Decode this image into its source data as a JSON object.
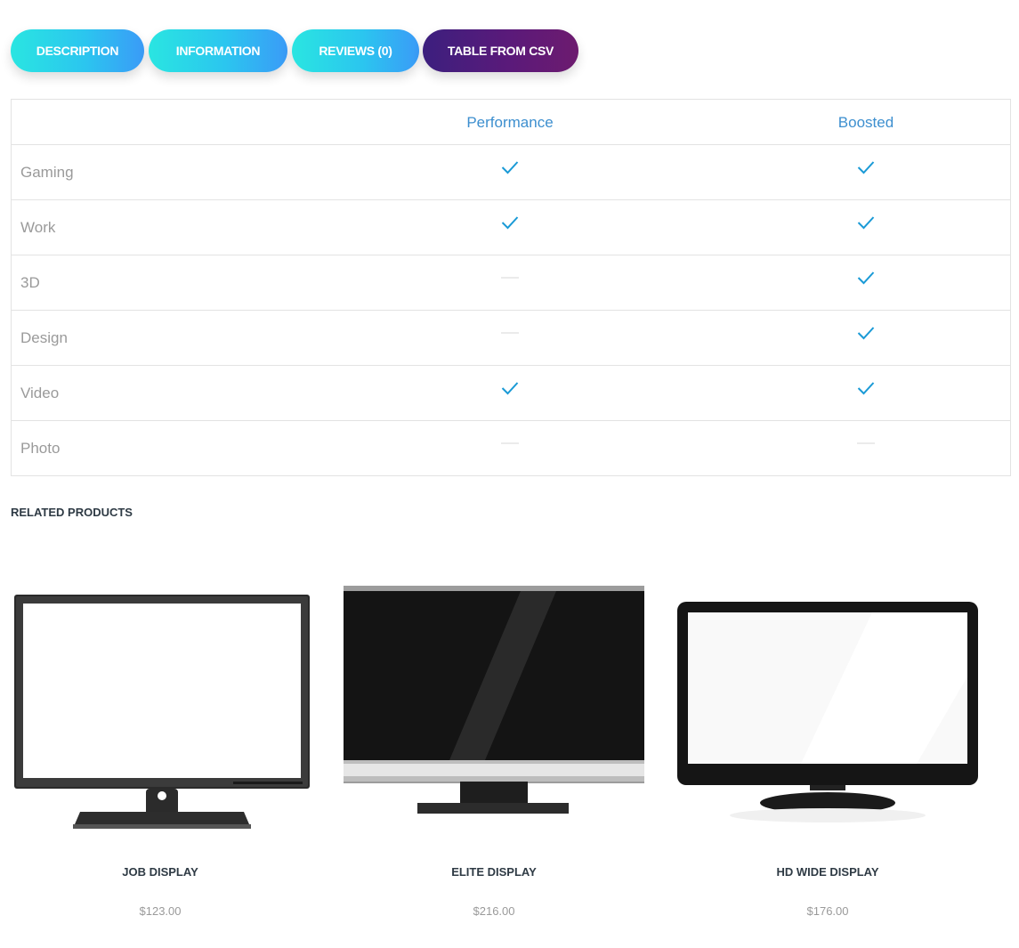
{
  "tabs": [
    {
      "label": "DESCRIPTION",
      "active": false
    },
    {
      "label": "INFORMATION",
      "active": false
    },
    {
      "label": "REVIEWS (0)",
      "active": false
    },
    {
      "label": "TABLE FROM CSV",
      "active": true
    }
  ],
  "table": {
    "columns": [
      "",
      "Performance",
      "Boosted"
    ],
    "rows": [
      {
        "label": "Gaming",
        "performance": "check",
        "boosted": "check"
      },
      {
        "label": "Work",
        "performance": "check",
        "boosted": "check"
      },
      {
        "label": "3D",
        "performance": "dash",
        "boosted": "check"
      },
      {
        "label": "Design",
        "performance": "dash",
        "boosted": "check"
      },
      {
        "label": "Video",
        "performance": "check",
        "boosted": "check"
      },
      {
        "label": "Photo",
        "performance": "dash",
        "boosted": "dash"
      }
    ]
  },
  "related": {
    "title": "RELATED PRODUCTS",
    "products": [
      {
        "name": "JOB DISPLAY",
        "price": "$123.00",
        "image_icon": "monitor-white-screen-icon"
      },
      {
        "name": "ELITE DISPLAY",
        "price": "$216.00",
        "image_icon": "monitor-black-screen-icon"
      },
      {
        "name": "HD WIDE DISPLAY",
        "price": "$176.00",
        "image_icon": "tv-white-screen-icon"
      }
    ]
  },
  "colors": {
    "tab_gradient_start": "#2ae5e1",
    "tab_gradient_end": "#3a9bf7",
    "active_tab_start": "#3c1f7e",
    "active_tab_end": "#6d1b6f",
    "header_text": "#3d8fcf",
    "check": "#1a9ad6",
    "label_text": "#9a9a9a"
  }
}
